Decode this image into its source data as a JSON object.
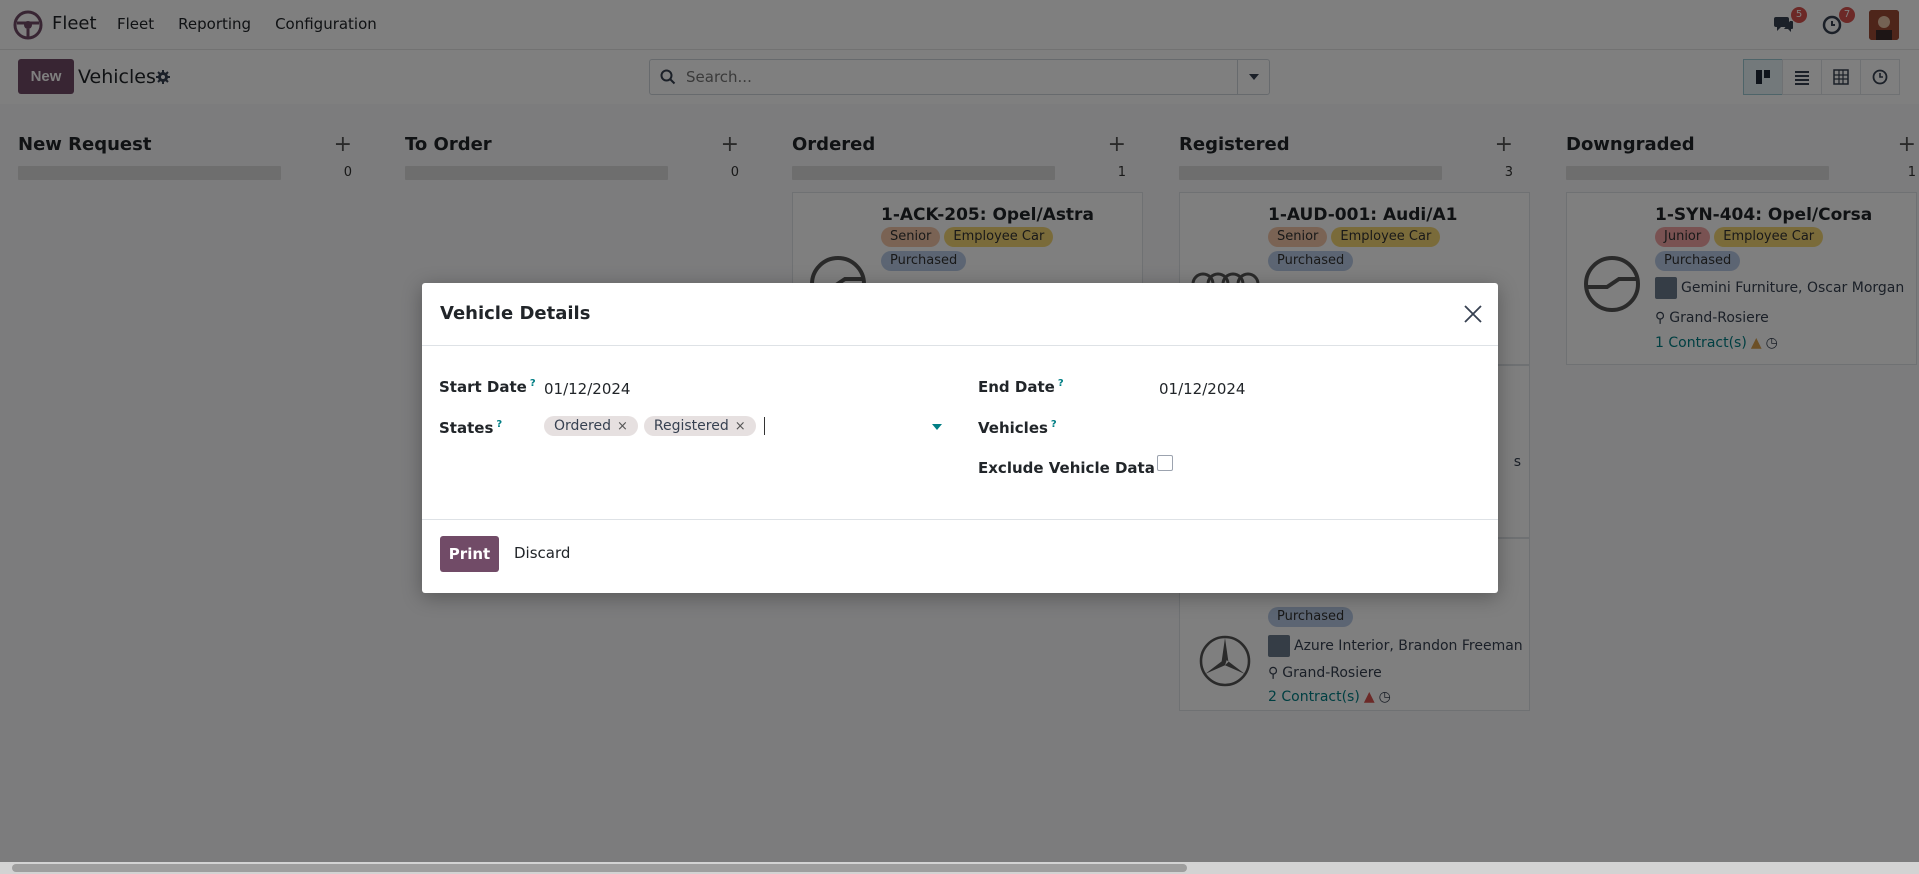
{
  "navbar": {
    "app_name": "Fleet",
    "menu": [
      "Fleet",
      "Reporting",
      "Configuration"
    ],
    "messages_badge": "5",
    "activities_badge": "7"
  },
  "control_panel": {
    "new_label": "New",
    "title": "Vehicles",
    "search_placeholder": "Search..."
  },
  "columns": [
    {
      "title": "New Request",
      "count": "0"
    },
    {
      "title": "To Order",
      "count": "0"
    },
    {
      "title": "Ordered",
      "count": "1"
    },
    {
      "title": "Registered",
      "count": "3"
    },
    {
      "title": "Downgraded",
      "count": "1"
    }
  ],
  "cards": {
    "opel_astra": {
      "title": "1-ACK-205: Opel/Astra",
      "tags": [
        "Senior",
        "Employee Car",
        "Purchased"
      ]
    },
    "audi_a1": {
      "title": "1-AUD-001: Audi/A1",
      "tags": [
        "Senior",
        "Employee Car",
        "Purchased"
      ],
      "partial_text": "s"
    },
    "mercedes": {
      "tag": "Purchased",
      "driver": "Azure Interior, Brandon Freeman",
      "location": "Grand-Rosiere",
      "contracts": "2 Contract(s)"
    },
    "opel_corsa": {
      "title": "1-SYN-404: Opel/Corsa",
      "tags": [
        "Junior",
        "Employee Car",
        "Purchased"
      ],
      "driver": "Gemini Furniture, Oscar Morgan",
      "location": "Grand-Rosiere",
      "contracts": "1 Contract(s)"
    }
  },
  "dialog": {
    "title": "Vehicle Details",
    "start_date_label": "Start Date",
    "start_date_value": "01/12/2024",
    "end_date_label": "End Date",
    "end_date_value": "01/12/2024",
    "states_label": "States",
    "states": [
      "Ordered",
      "Registered"
    ],
    "vehicles_label": "Vehicles",
    "exclude_label": "Exclude Vehicle Data",
    "help_mark": "?",
    "print_label": "Print",
    "discard_label": "Discard"
  },
  "colors": {
    "primary": "#714b67",
    "link": "#017e84"
  }
}
